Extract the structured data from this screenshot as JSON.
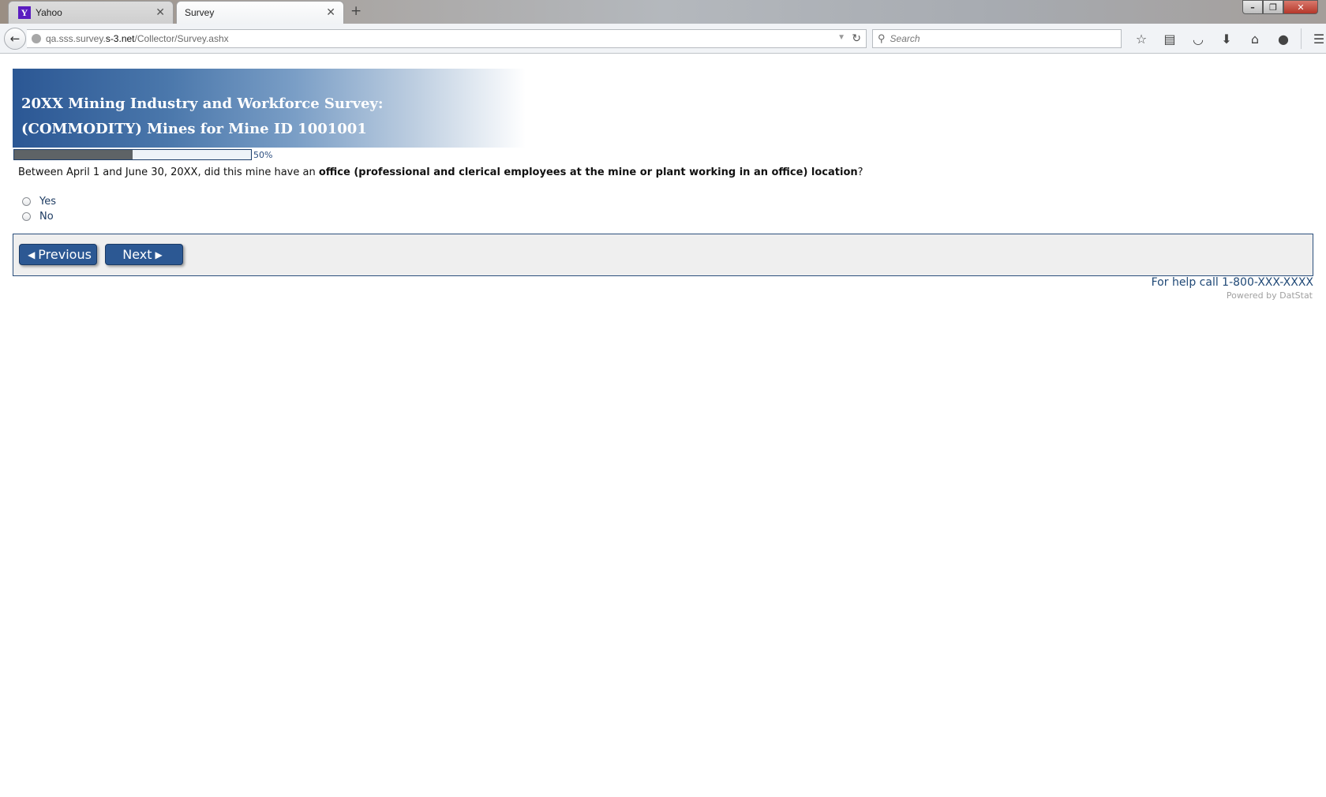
{
  "browser": {
    "tabs": [
      {
        "label": "Yahoo",
        "icon": "yahoo-icon",
        "active": false
      },
      {
        "label": "Survey",
        "active": true
      }
    ],
    "url": {
      "prefix": "qa.sss.survey.",
      "domain": "s-3.net",
      "path": "/Collector/Survey.ashx"
    },
    "search_placeholder": "Search",
    "toolbar_icons": [
      "bookmark-star-icon",
      "reading-list-icon",
      "pocket-icon",
      "download-icon",
      "home-icon",
      "chat-icon",
      "menu-icon"
    ]
  },
  "survey": {
    "header": {
      "line1": "20XX Mining Industry and Workforce Survey:",
      "line2": "(COMMODITY) Mines for Mine ID 1001001"
    },
    "progress": {
      "value": 0.5,
      "label": "50%"
    },
    "question": {
      "prefix": "Between April 1 and June 30, 20XX, did this mine have an ",
      "emphasis": "office (professional and clerical employees at the mine or plant working in an office) location",
      "suffix": "?"
    },
    "options": [
      {
        "label": "Yes",
        "selected": false
      },
      {
        "label": "No",
        "selected": false
      }
    ],
    "buttons": {
      "previous": "Previous",
      "next": "Next"
    },
    "help_text": "For help call 1-800-XXX-XXXX",
    "powered_by": "Powered by DatStat"
  },
  "colors": {
    "brand_blue": "#2c5893",
    "progress_fill": "#5e6366",
    "panel_bg": "#efefef"
  }
}
